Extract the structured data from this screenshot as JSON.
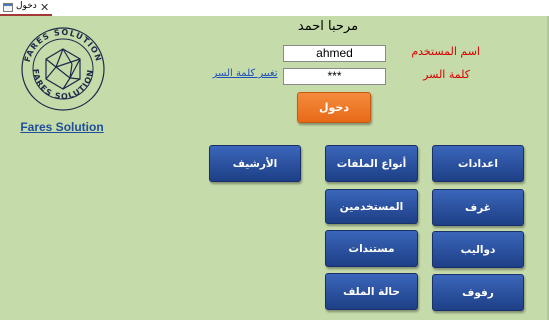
{
  "tab": {
    "title": "دخول",
    "close_glyph": "✕",
    "icon": "form-icon"
  },
  "logo": {
    "icon": "hexagon-sphere-logo",
    "ring_text": "FARES SOLUTION",
    "caption": "Fares Solution"
  },
  "welcome": "مرحبا احمد",
  "login": {
    "username_label": "اسم المستخدم",
    "username_value": "ahmed",
    "password_label": "كلمة السر",
    "password_value": "***",
    "change_password_link": "تغيير كلمة السر",
    "submit_label": "دخول"
  },
  "buttons": {
    "settings": "اعدادات",
    "file_types": "أنواع الملفات",
    "archive": "الأرشيف",
    "rooms": "غرف",
    "users": "المستخدمين",
    "cabinets": "دواليب",
    "documents": "مستندات",
    "shelves": "رفوف",
    "file_status": "حالة الملف"
  },
  "colors": {
    "form_background": "#c6dbaa",
    "nav_button": "#2a52a3",
    "login_button": "#ef7a26",
    "label_red": "#d80000",
    "tab_accent": "#a4373a",
    "brand_blue": "#1f4f9c"
  }
}
